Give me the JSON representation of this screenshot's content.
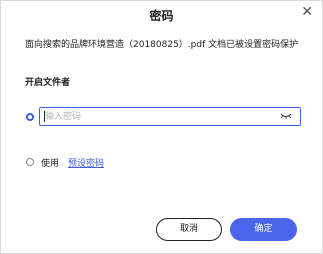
{
  "dialog": {
    "title": "密码",
    "close_glyph": "✕",
    "close_icon": "close-icon"
  },
  "message": "面向搜索的品牌环境营造（20180825）.pdf 文档已被设置密码保护",
  "section_label": "开启文件者",
  "password_option": {
    "selected": true,
    "placeholder": "输入密码",
    "value": "",
    "toggle_icon": "eye-closed-icon"
  },
  "preset_option": {
    "selected": false,
    "label": "使用",
    "link_text": "预设密码"
  },
  "buttons": {
    "cancel": "取消",
    "ok": "确定"
  },
  "colors": {
    "accent": "#3f5de6",
    "primary_button": "#4a64ea"
  }
}
